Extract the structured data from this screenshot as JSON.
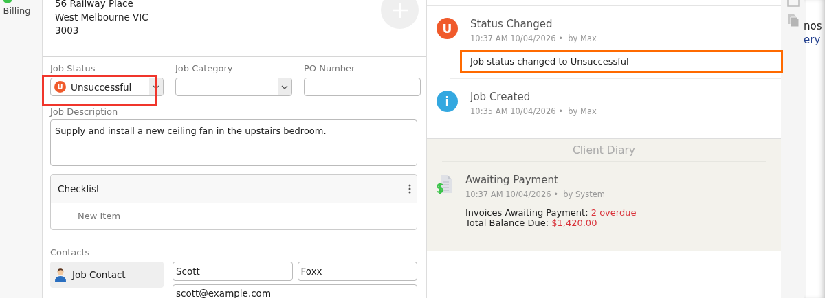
{
  "sidebar": {
    "items": [
      {
        "label": "Billing"
      }
    ]
  },
  "address": {
    "lines": [
      "56 Railway Place",
      "West Melbourne VIC",
      "3003"
    ]
  },
  "fields": [
    {
      "kind": "status-select",
      "label": "Job Status",
      "value": "Unsuccessful",
      "badge": "U",
      "highlighted": true
    },
    {
      "kind": "select",
      "label": "Job Category",
      "highlighted": false
    },
    {
      "kind": "text",
      "label": "PO Number",
      "highlighted": false
    }
  ],
  "description": {
    "label": "Job Description",
    "value": "Supply and install a new ceiling fan in the upstairs bedroom."
  },
  "checklist": {
    "title": "Checklist",
    "new_item": "New Item"
  },
  "contacts": {
    "label": "Contacts",
    "tabs": [
      {
        "label": "Job Contact",
        "selected": true
      }
    ],
    "first_name": "Scott",
    "last_name": "Foxx",
    "email": "scott@example.com"
  },
  "activity": [
    {
      "kind": "status",
      "badge": "U",
      "title": "Status Changed",
      "time": "10:37 AM 10/04/2026",
      "separator": "•",
      "by": "by Max",
      "note": "Job status changed to Unsuccessful",
      "highlighted": true
    },
    {
      "kind": "info",
      "badge": "i",
      "title": "Job Created",
      "time": "10:35 AM 10/04/2026",
      "separator": "•",
      "by": "by Max"
    }
  ],
  "client_diary": {
    "title": "Client Diary",
    "entries": [
      {
        "title": "Awaiting Payment",
        "time": "10:37 AM 10/04/2026",
        "separator": "•",
        "by": "by System",
        "lines": [
          {
            "label": "Invoices Awaiting Payment:",
            "value": "2 overdue"
          },
          {
            "label": "Total Balance Due:",
            "value": "$1,420.00"
          }
        ]
      }
    ]
  },
  "side_text": [
    {
      "text": "nos",
      "kind": "plain"
    },
    {
      "text": "ery",
      "kind": "link"
    }
  ]
}
